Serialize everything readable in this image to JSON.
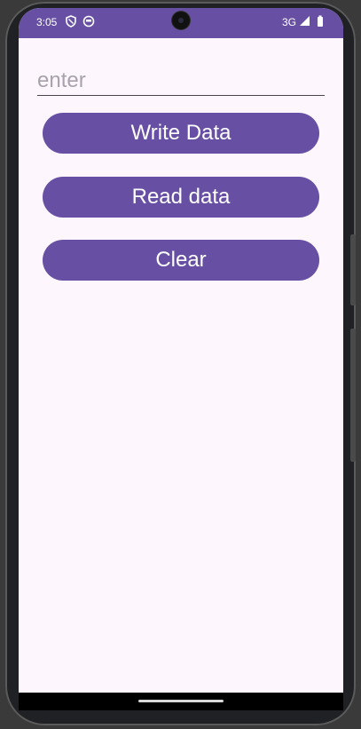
{
  "status_bar": {
    "time": "3:05",
    "network": "3G",
    "icons": [
      "shield-icon",
      "notification-app-icon",
      "signal-icon",
      "battery-icon"
    ],
    "background_color": "#6750a4"
  },
  "input": {
    "placeholder": "enter",
    "value": ""
  },
  "buttons": {
    "write_label": "Write Data",
    "read_label": "Read data",
    "clear_label": "Clear"
  },
  "colors": {
    "accent": "#6750a4",
    "screen_background": "#fdf6fd"
  }
}
